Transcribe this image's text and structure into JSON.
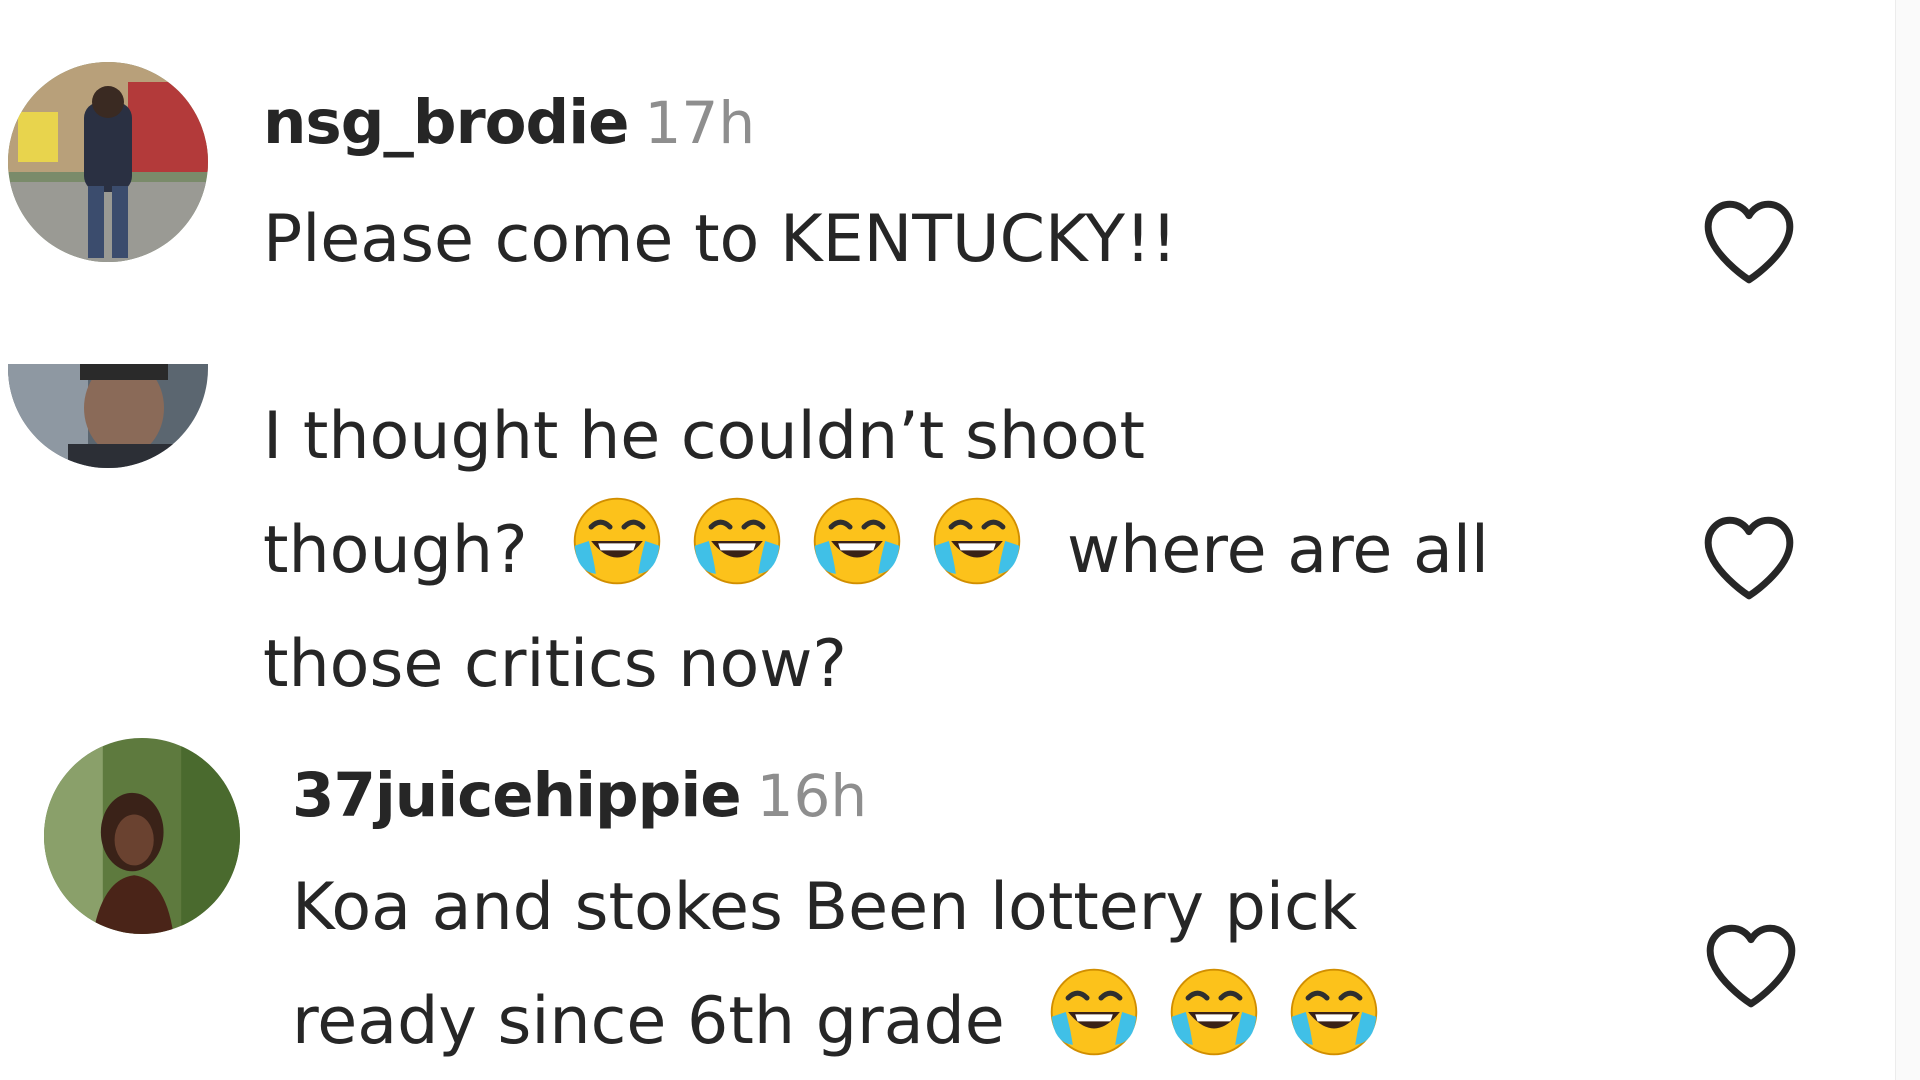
{
  "comments": [
    {
      "username": "nsg_brodie",
      "time": "17h",
      "lines": [
        "Please come to KENTUCKY!!"
      ],
      "avatar_icon": "user-photo-avatar",
      "like_icon": "heart-outline-icon"
    },
    {
      "username": "",
      "time": "",
      "lines": [
        "I thought he couldn’t shoot",
        "though?",
        "where are all",
        "those critics now?"
      ],
      "emoji_count": 4,
      "emoji_icon": "face-with-tears-of-joy-emoji",
      "avatar_icon": "user-photo-avatar",
      "like_icon": "heart-outline-icon"
    },
    {
      "username": "37juicehippie",
      "time": "16h",
      "lines": [
        "Koa and stokes Been lottery pick",
        "ready since 6th grade"
      ],
      "emoji_count": 3,
      "emoji_icon": "face-with-tears-of-joy-emoji",
      "avatar_icon": "user-photo-avatar",
      "like_icon": "heart-outline-icon"
    }
  ],
  "colors": {
    "text": "#262626",
    "muted": "#8e8e8e",
    "heart_stroke": "#262626",
    "emoji_face": "#fcc21b",
    "emoji_tears": "#40c0e7"
  }
}
